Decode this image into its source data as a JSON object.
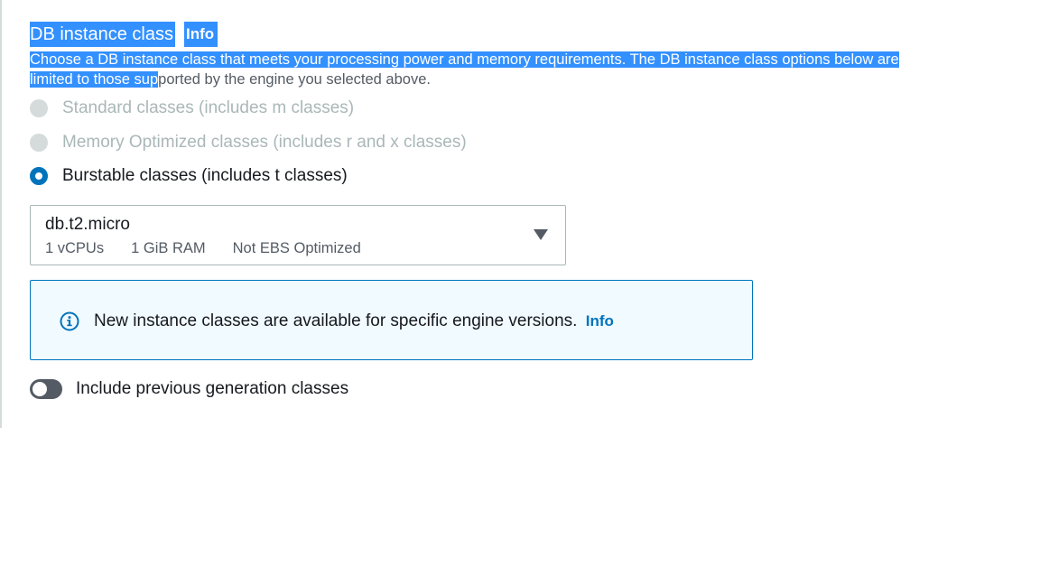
{
  "section": {
    "title": "DB instance class",
    "info_label": "Info",
    "description_selected_line1": "Choose a DB instance class that meets your processing power and memory requirements. The DB instance class options below are",
    "description_selected_line2": "limited to those sup",
    "description_rest": "ported by the engine you selected above."
  },
  "classes": {
    "options": [
      {
        "label": "Standard classes (includes m classes)",
        "state": "disabled"
      },
      {
        "label": "Memory Optimized classes (includes r and x classes)",
        "state": "disabled"
      },
      {
        "label": "Burstable classes (includes t classes)",
        "state": "selected"
      }
    ]
  },
  "instance_select": {
    "value": "db.t2.micro",
    "vcpus": "1 vCPUs",
    "ram": "1 GiB RAM",
    "ebs": "Not EBS Optimized",
    "caret_icon": "caret-down-icon"
  },
  "alert": {
    "icon": "info-circle-icon",
    "message": "New instance classes are available for specific engine versions.",
    "link_label": "Info"
  },
  "previous_generation": {
    "label": "Include previous generation classes",
    "enabled": false
  },
  "colors": {
    "accent": "#0073bb",
    "selection": "#3390ff",
    "alert_background": "#f1faff",
    "toggle_off": "#545b64",
    "disabled_text": "#aab7b8"
  }
}
